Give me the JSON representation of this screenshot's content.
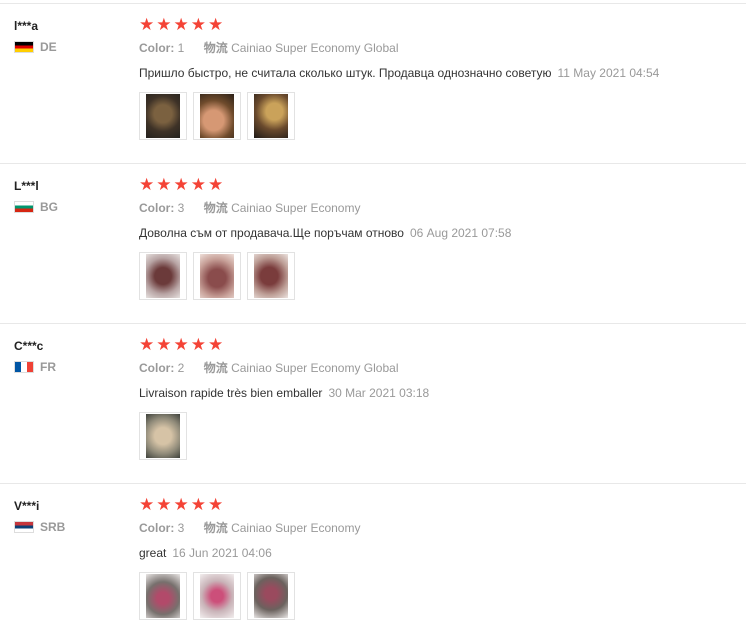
{
  "stars": [
    "★",
    "★",
    "★",
    "★",
    "★"
  ],
  "reviews": [
    {
      "user": "l***a",
      "country": "DE",
      "flag_icon": "germany-flag-icon",
      "color_label": "Color:",
      "color_value": "1",
      "logistics_label": "物流",
      "logistics_value": "Cainiao Super Economy Global",
      "text": "Пришло быстро, не считала сколько штук. Продавца однозначно советую",
      "date": "11 May 2021 04:54",
      "photos": 3
    },
    {
      "user": "L***l",
      "country": "BG",
      "flag_icon": "bulgaria-flag-icon",
      "color_label": "Color:",
      "color_value": "3",
      "logistics_label": "物流",
      "logistics_value": "Cainiao Super Economy",
      "text": "Доволна съм от продавача.Ще поръчам отново",
      "date": "06 Aug 2021 07:58",
      "photos": 3
    },
    {
      "user": "C***c",
      "country": "FR",
      "flag_icon": "france-flag-icon",
      "color_label": "Color:",
      "color_value": "2",
      "logistics_label": "物流",
      "logistics_value": "Cainiao Super Economy Global",
      "text": "Livraison rapide très bien emballer",
      "date": "30 Mar 2021 03:18",
      "photos": 1
    },
    {
      "user": "V***i",
      "country": "SRB",
      "flag_icon": "serbia-flag-icon",
      "color_label": "Color:",
      "color_value": "3",
      "logistics_label": "物流",
      "logistics_value": "Cainiao Super Economy",
      "text": "great",
      "date": "16 Jun 2021 04:06",
      "photos": 3
    }
  ],
  "colors": {
    "star": "#f44336",
    "muted": "#999999",
    "divider": "#e8e8e8"
  }
}
